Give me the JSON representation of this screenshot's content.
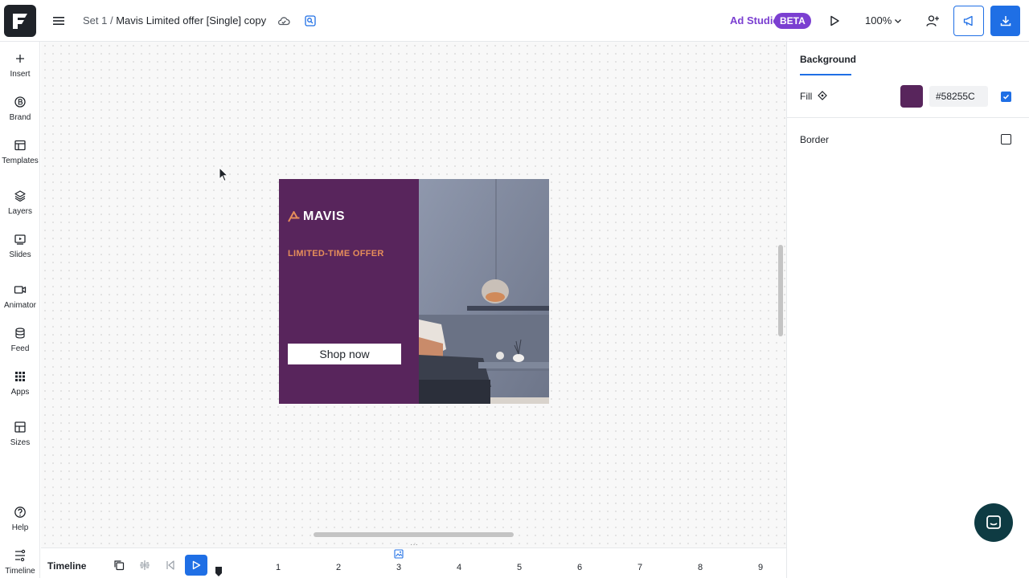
{
  "header": {
    "breadcrumb_prefix": "Set 1 /",
    "document_title": "Mavis Limited offer [Single] copy",
    "ad_studio_label": "Ad Studio",
    "beta_badge": "BETA",
    "zoom_level": "100%"
  },
  "sidebar": {
    "items": [
      {
        "label": "Insert",
        "icon": "plus-icon"
      },
      {
        "label": "Brand",
        "icon": "brand-icon"
      },
      {
        "label": "Templates",
        "icon": "templates-icon"
      },
      {
        "label": "Layers",
        "icon": "layers-icon"
      },
      {
        "label": "Slides",
        "icon": "slides-icon"
      },
      {
        "label": "Animator",
        "icon": "animator-icon"
      },
      {
        "label": "Feed",
        "icon": "feed-icon"
      },
      {
        "label": "Apps",
        "icon": "apps-icon"
      },
      {
        "label": "Sizes",
        "icon": "sizes-icon"
      },
      {
        "label": "Help",
        "icon": "help-icon"
      },
      {
        "label": "Timeline",
        "icon": "timeline-icon"
      }
    ]
  },
  "ad": {
    "brand_name": "MAVIS",
    "offer_text": "LIMITED-TIME OFFER",
    "cta_label": "Shop now",
    "background_color": "#58255C",
    "accent_color": "#E58D5A"
  },
  "panel": {
    "tab_label": "Background",
    "fill_label": "Fill",
    "fill_hex": "#58255C",
    "fill_enabled": true,
    "border_label": "Border",
    "border_enabled": false
  },
  "timeline": {
    "title": "Timeline",
    "ticks": [
      "1",
      "2",
      "3",
      "4",
      "5",
      "6",
      "7",
      "8",
      "9"
    ]
  },
  "colors": {
    "primary": "#1F6FE5",
    "ad_studio": "#7B3FD1",
    "chat": "#0E3B43"
  }
}
